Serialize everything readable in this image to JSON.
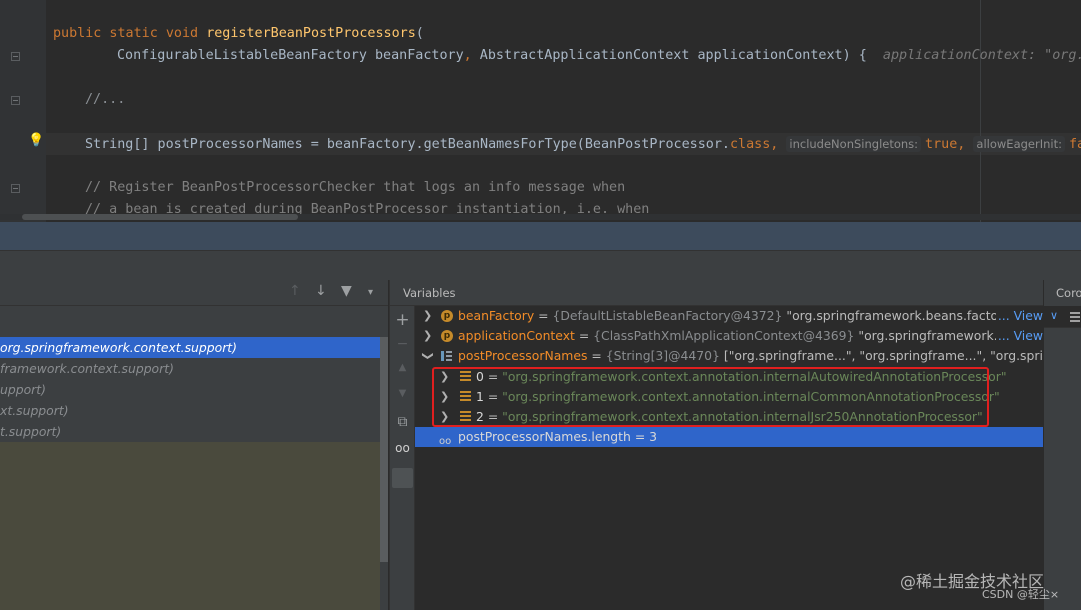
{
  "editor": {
    "lines": [
      {
        "kw": "public static void ",
        "fn": "registerBeanPostProcessors",
        "rest": "("
      },
      {
        "text": "ConfigurableListableBeanFactory beanFactory",
        "sep": ", ",
        "text2": "AbstractApplicationContext applicationContext) {",
        "hint": "applicationContext: \"org.s"
      },
      {
        "text": "//..."
      },
      {
        "text": "String[] postProcessorNames = beanFactory.getBeanNamesForType(BeanPostProcessor.",
        "kw": "class",
        "sep": ",",
        "param1": "includeNonSingletons:",
        "val1": "true",
        "sep2": ",",
        "param2": "allowEagerInit:",
        "val2": "fa"
      },
      {
        "text": "// Register BeanPostProcessorChecker that logs an info message when"
      },
      {
        "text": "// a bean is created during BeanPostProcessor instantiation, i.e. when"
      }
    ]
  },
  "frames": {
    "items": [
      {
        "label": "org.springframework.context.support)",
        "selected": true
      },
      {
        "label": "framework.context.support)",
        "selected": false
      },
      {
        "label": "upport)",
        "selected": false
      },
      {
        "label": "xt.support)",
        "selected": false
      },
      {
        "label": "t.support)",
        "selected": false
      }
    ]
  },
  "variables": {
    "title": "Variables",
    "rows": [
      {
        "name": "beanFactory",
        "eq": " = ",
        "type": "{DefaultListableBeanFactory@4372}",
        "value": " \"org.springframework.beans.factory.suppo",
        "link": "... View"
      },
      {
        "name": "applicationContext",
        "eq": " = ",
        "type": "{ClassPathXmlApplicationContext@4369}",
        "value": " \"org.springframework.context.su",
        "link": "... View"
      },
      {
        "name": "postProcessorNames",
        "eq": " = ",
        "type": "{String[3]@4470}",
        "value": " [\"org.springframe...\", \"org.springframe...\", \"org.springframe"
      },
      {
        "name": "0",
        "eq": " = ",
        "value": "\"org.springframework.context.annotation.internalAutowiredAnnotationProcessor\""
      },
      {
        "name": "1",
        "eq": " = ",
        "value": "\"org.springframework.context.annotation.internalCommonAnnotationProcessor\""
      },
      {
        "name": "2",
        "eq": " = ",
        "value": "\"org.springframework.context.annotation.internalJsr250AnnotationProcessor\""
      },
      {
        "name": "postProcessorNames.length",
        "eq": " = ",
        "value": "3"
      }
    ]
  },
  "coroutines": {
    "title": "Corou",
    "selector": "∨"
  },
  "watermark": {
    "line1": "@稀土掘金技术社区",
    "line2": "CSDN @轻尘×"
  },
  "colors": {
    "accent": "#2f65ca",
    "highlight_box": "#e01f1f",
    "string": "#6a8759",
    "field": "#f28c28"
  }
}
